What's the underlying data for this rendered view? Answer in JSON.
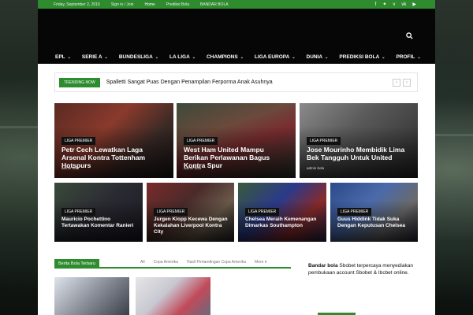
{
  "topbar": {
    "date": "Friday, September 2, 2016",
    "signin": "Sign in / Join",
    "home": "Home",
    "prediksi": "Prediksi Bola",
    "bandar": "BANDAR BOLA",
    "social_icons": [
      "facebook-icon",
      "twitter-icon",
      "vimeo-icon",
      "vk-icon",
      "youtube-icon"
    ]
  },
  "nav": {
    "items": [
      "EPL",
      "SERIE A",
      "BUNDESLIGA",
      "LA LIGA",
      "CHAMPIONS",
      "LIGA EUROPA",
      "DUNIA",
      "PREDIKSI BOLA",
      "PROFIL"
    ]
  },
  "trending": {
    "badge": "TRENDING NOW",
    "headline": "Spalletti Sangat Puas Dengan Penampilan Ferporma Anak Asuhnya"
  },
  "big_cards": [
    {
      "category": "LIGA PREMIER",
      "title": "Petr Cech Lewatkan Laga Arsenal Kontra Tottenham Hotspurs",
      "author": "admin bola"
    },
    {
      "category": "LIGA PREMIER",
      "title": "West Ham United Mampu Berikan Perlawanan Bagus Kontra Spur",
      "author": "admin bola"
    },
    {
      "category": "LIGA PREMIER",
      "title": "Jose Mourinho Membidik Lima Bek Tangguh Untuk United",
      "author": "admin bola"
    }
  ],
  "small_cards": [
    {
      "category": "LIGA PREMIER",
      "title": "Mauricio Pochettino Tertawakan Komentar Ranieri"
    },
    {
      "category": "LIGA PREMIER",
      "title": "Jurgen Klopp Kecewa Dengan Kekalahan Liverpool Kontra City"
    },
    {
      "category": "LIGA PREMIER",
      "title": "Chelsea Meraih Kemenangan Dimarkas Southampton"
    },
    {
      "category": "LIGA PREMIER",
      "title": "Guus Hiddink Tidak Suka Dengan Keputusan Chelsea"
    }
  ],
  "section": {
    "label": "Berita Bola Terbaru",
    "links": [
      "All",
      "Copa Amerika",
      "Hasil Pertandingan Copa Amerika"
    ],
    "more": "More"
  },
  "sidebar": {
    "bold": "Bandar bola",
    "text": " Sbobet terpercaya menyediakan pembukaan account Sbobet & Ibcbet online."
  },
  "colors": {
    "accent": "#2e8b2e",
    "header": "#060606"
  }
}
